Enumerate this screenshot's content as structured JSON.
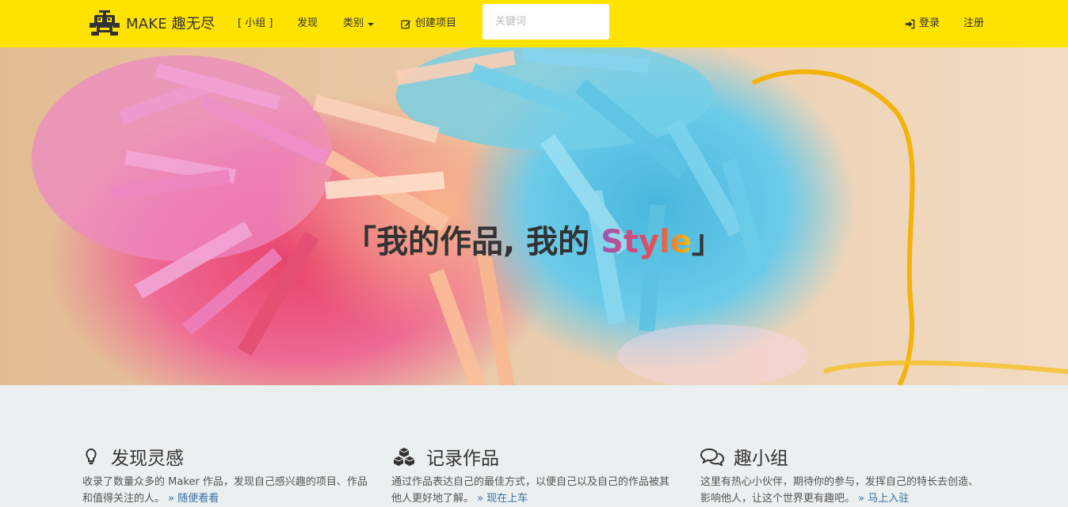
{
  "navbar": {
    "brand": "MAKE 趣无尽",
    "brand_icon": "robot-logo-icon",
    "items": {
      "groups": "[ 小组 ]",
      "discover": "发现",
      "category": "类别",
      "create": "创建项目"
    },
    "search_placeholder": "关键词",
    "login": "登录",
    "register": "注册",
    "bg_color": "#ffe300"
  },
  "hero": {
    "slogan_left": "「我的作品, 我的 ",
    "slogan_style": "Style",
    "slogan_right": "」"
  },
  "features": [
    {
      "icon": "lightbulb-icon",
      "title": "发现灵感",
      "desc": "收录了数量众多的 Maker 作品，发现自己感兴趣的项目、作品和值得关注的人。",
      "link": "» 随便看看"
    },
    {
      "icon": "cubes-icon",
      "title": "记录作品",
      "desc": "通过作品表达自己的最佳方式，以便自己以及自己的作品被其他人更好地了解。",
      "link": "» 现在上车"
    },
    {
      "icon": "comments-icon",
      "title": "趣小组",
      "desc": "这里有热心小伙伴，期待你的参与，发挥自己的特长去创造、影响他人，让这个世界更有趣吧。",
      "link": "» 马上入驻"
    }
  ]
}
